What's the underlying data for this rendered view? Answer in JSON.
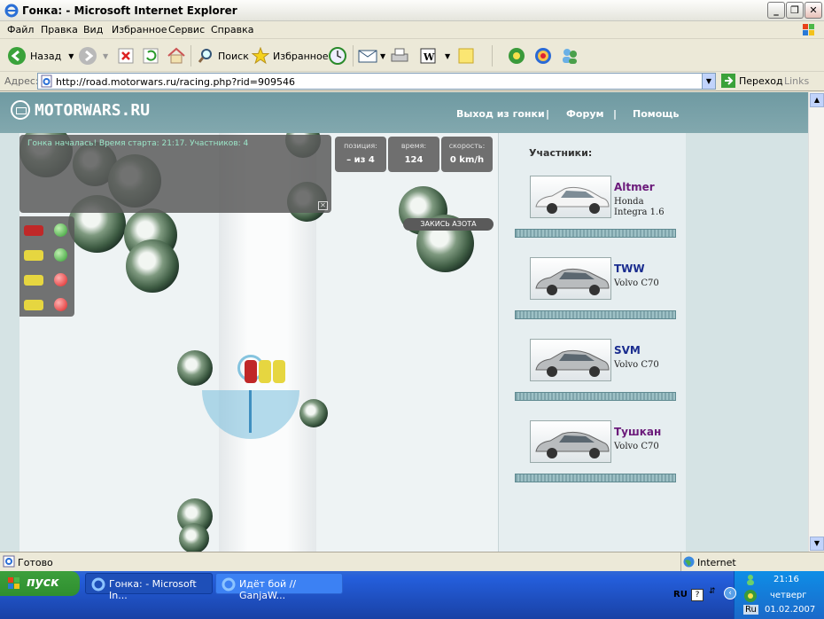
{
  "window": {
    "title": "Гонка: - Microsoft Internet Explorer"
  },
  "menu": [
    "Файл",
    "Правка",
    "Вид",
    "Избранное",
    "Сервис",
    "Справка"
  ],
  "toolbar": {
    "back": "Назад",
    "search": "Поиск",
    "favorites": "Избранное"
  },
  "address": {
    "label": "Адрес:",
    "url": "http://road.motorwars.ru/racing.php?rid=909546",
    "go": "Переход",
    "links": "Links"
  },
  "site": {
    "logo": "MOTORWARS.RU",
    "nav": [
      "Выход из гонки",
      "Форум",
      "Помощь"
    ],
    "nav_sep": "|"
  },
  "race": {
    "message": "Гонка началась! Время старта: 21:17. Участников: 4",
    "stats": [
      {
        "key": "позиция:",
        "value": "– из 4"
      },
      {
        "key": "время:",
        "value": "124"
      },
      {
        "key": "скорость:",
        "value": "0 km/h"
      }
    ],
    "nitro": "ЗАКИСЬ АЗОТА",
    "close": "✕"
  },
  "participants": {
    "title": "Участники:",
    "list": [
      {
        "name": "Altmer",
        "model": "Honda Integra 1.6",
        "color": "#6b1a7a"
      },
      {
        "name": "TWW",
        "model": "Volvo C70",
        "color": "#1a2d8f"
      },
      {
        "name": "SVM",
        "model": "Volvo C70",
        "color": "#1a2d8f"
      },
      {
        "name": "Тушкан",
        "model": "Volvo C70",
        "color": "#6b1a7a"
      }
    ]
  },
  "status": {
    "text": "Готово",
    "zone": "Internet"
  },
  "taskbar": {
    "start": "пуск",
    "tasks": [
      "Гонка: - Microsoft In...",
      "Идёт бой // GanjaW..."
    ],
    "lang": "RU",
    "tray_lang": "Ru",
    "time": "21:16",
    "day": "четверг",
    "date": "01.02.2007"
  }
}
